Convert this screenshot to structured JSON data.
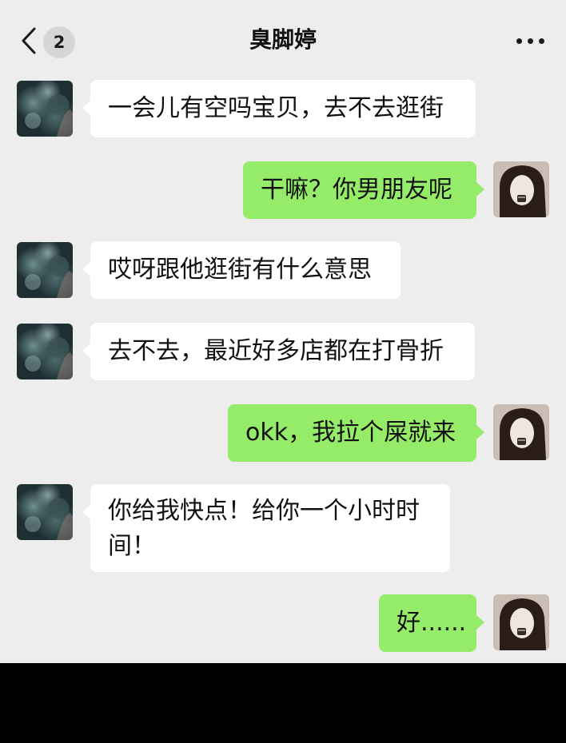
{
  "header": {
    "back_icon": "chevron-left-icon",
    "unread_count": "2",
    "title": "臭脚婷",
    "more_icon": "more-dots-icon"
  },
  "colors": {
    "background": "#ededed",
    "incoming_bubble": "#ffffff",
    "outgoing_bubble": "#95ec69"
  },
  "messages": [
    {
      "from": "other",
      "text": "一会儿有空吗宝贝，去不去逛街"
    },
    {
      "from": "self",
      "text": "干嘛？你男朋友呢"
    },
    {
      "from": "other",
      "text": "哎呀跟他逛街有什么意思"
    },
    {
      "from": "other",
      "text": "去不去，最近好多店都在打骨折"
    },
    {
      "from": "self",
      "text": "okk，我拉个屎就来"
    },
    {
      "from": "other",
      "text": "你给我快点！给你一个小时时\n间！"
    },
    {
      "from": "self",
      "text": "好......"
    }
  ]
}
